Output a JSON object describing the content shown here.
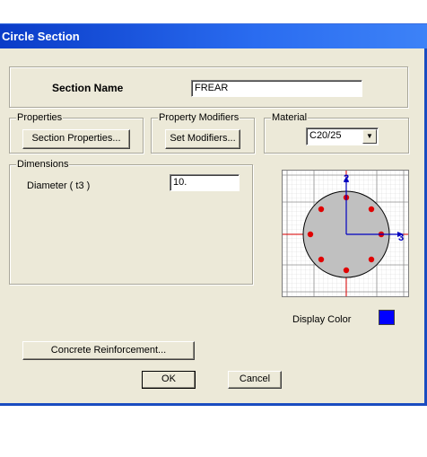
{
  "window": {
    "title": "Circle Section"
  },
  "section_name": {
    "label": "Section Name",
    "value": "FREAR"
  },
  "properties": {
    "group_label": "Properties",
    "button_label": "Section Properties..."
  },
  "property_modifiers": {
    "group_label": "Property Modifiers",
    "button_label": "Set Modifiers..."
  },
  "material": {
    "group_label": "Material",
    "selected": "C20/25"
  },
  "dimensions": {
    "group_label": "Dimensions",
    "diameter_label": "Diameter  ( t3 )",
    "diameter_value": "10."
  },
  "preview": {
    "axis_2_label": "2",
    "axis_3_label": "3",
    "circle_color": "#c0c0c0",
    "rebar_color": "#e00000",
    "axis_color": "#0000c0",
    "grid_color": "#b0b0b0"
  },
  "display_color": {
    "label": "Display Color",
    "color": "#0000ff"
  },
  "buttons": {
    "concrete_reinforcement": "Concrete Reinforcement...",
    "ok": "OK",
    "cancel": "Cancel"
  }
}
